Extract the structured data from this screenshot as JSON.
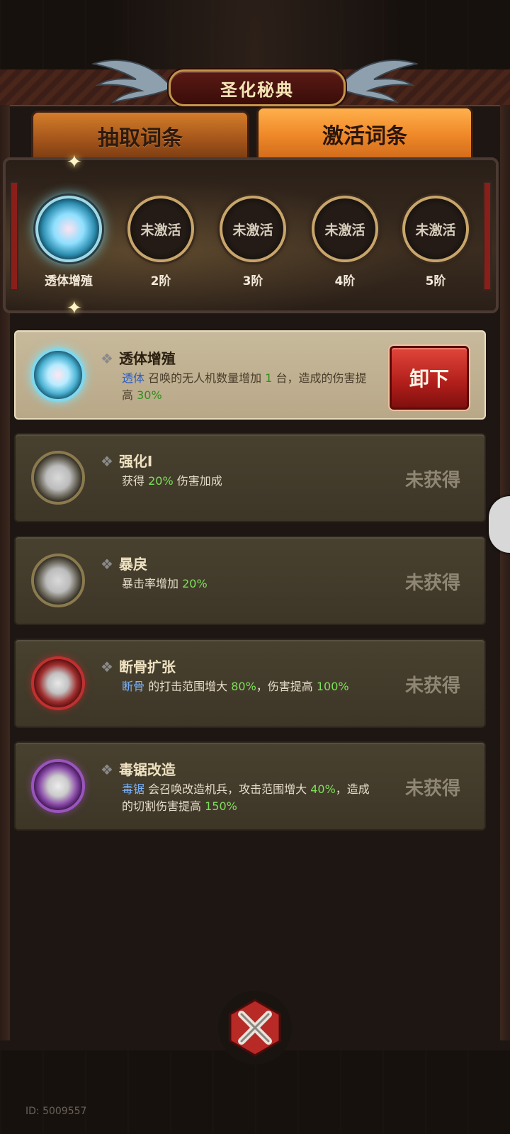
{
  "title": "圣化秘典",
  "tabs": [
    {
      "label": "抽取词条",
      "active": false
    },
    {
      "label": "激活词条",
      "active": true
    }
  ],
  "tiers": [
    {
      "ring_text": "",
      "label": "透体增殖",
      "active": true
    },
    {
      "ring_text": "未激活",
      "label": "2阶",
      "active": false
    },
    {
      "ring_text": "未激活",
      "label": "3阶",
      "active": false
    },
    {
      "ring_text": "未激活",
      "label": "4阶",
      "active": false
    },
    {
      "ring_text": "未激活",
      "label": "5阶",
      "active": false
    }
  ],
  "skills": [
    {
      "name": "透体增殖",
      "desc_parts": [
        {
          "t": "透体",
          "s": "kw"
        },
        {
          "t": " 召唤的无人机数量增加 ",
          "s": ""
        },
        {
          "t": "1",
          "s": "num"
        },
        {
          "t": " 台，造成的伤害提高 ",
          "s": ""
        },
        {
          "t": "30%",
          "s": "num"
        }
      ],
      "orb": "cyan",
      "action_label": "卸下"
    },
    {
      "name": "强化I",
      "desc_parts": [
        {
          "t": "获得 ",
          "s": ""
        },
        {
          "t": "20%",
          "s": "num"
        },
        {
          "t": " 伤害加成",
          "s": ""
        }
      ],
      "orb": "gold",
      "status": "未获得"
    },
    {
      "name": "暴戾",
      "desc_parts": [
        {
          "t": "暴击率增加 ",
          "s": ""
        },
        {
          "t": "20%",
          "s": "num"
        }
      ],
      "orb": "gold",
      "status": "未获得"
    },
    {
      "name": "断骨扩张",
      "desc_parts": [
        {
          "t": "断骨",
          "s": "kw"
        },
        {
          "t": " 的打击范围增大 ",
          "s": ""
        },
        {
          "t": "80%",
          "s": "num"
        },
        {
          "t": "，伤害提高 ",
          "s": ""
        },
        {
          "t": "100%",
          "s": "num"
        }
      ],
      "orb": "red",
      "status": "未获得"
    },
    {
      "name": "毒锯改造",
      "desc_parts": [
        {
          "t": "毒锯",
          "s": "kw"
        },
        {
          "t": " 会召唤改造机兵，攻击范围增大 ",
          "s": ""
        },
        {
          "t": "40%",
          "s": "num"
        },
        {
          "t": "，造成的切割伤害提高 ",
          "s": ""
        },
        {
          "t": "150%",
          "s": "num"
        }
      ],
      "orb": "purple",
      "status": "未获得"
    }
  ],
  "footer": {
    "id_text": "ID: 5009557"
  },
  "icons": {
    "close": "close-x-icon",
    "orb": "skill-orb-icon"
  }
}
